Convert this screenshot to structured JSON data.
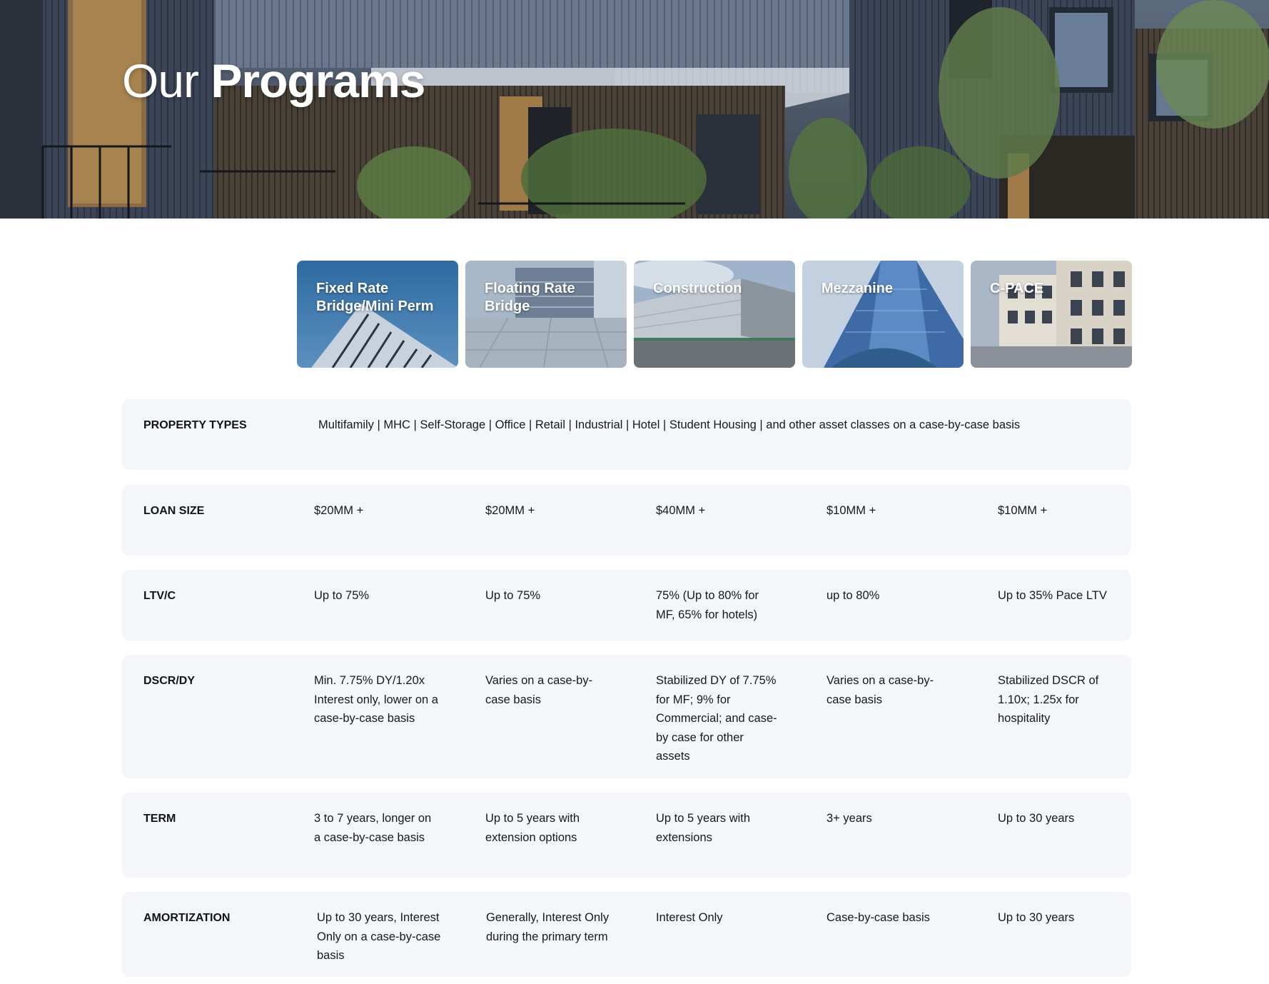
{
  "hero": {
    "title_light": "Our",
    "title_bold": "Programs"
  },
  "programs": [
    {
      "label": "Fixed Rate Bridge/Mini Perm",
      "art": "glass-building-photo"
    },
    {
      "label": "Floating Rate Bridge",
      "art": "plaza-office-photo"
    },
    {
      "label": "Construction",
      "art": "warehouse-photo"
    },
    {
      "label": "Mezzanine",
      "art": "glass-tower-photo"
    },
    {
      "label": "C-PACE",
      "art": "townhouse-facade-photo"
    }
  ],
  "rows": {
    "property_types": {
      "header": "PROPERTY TYPES",
      "value": "Multifamily | MHC | Self-Storage | Office | Retail | Industrial | Hotel | Student Housing | and other asset classes on a case-by-case basis"
    },
    "loan_size": {
      "header": "LOAN SIZE",
      "values": [
        "$20MM +",
        "$20MM +",
        "$40MM +",
        "$10MM +",
        "$10MM +"
      ]
    },
    "ltv": {
      "header": "LTV/C",
      "values": [
        "Up to 75%",
        "Up to 75%",
        "75% (Up to 80% for MF, 65% for hotels)",
        "up to 80%",
        "Up to 35% Pace LTV"
      ]
    },
    "dscr": {
      "header": "DSCR/DY",
      "values": [
        "Min. 7.75% DY/1.20x Interest only, lower on a case-by-case basis",
        "Varies on a case-by-case basis",
        "Stabilized DY of 7.75% for MF; 9% for Commercial; and case-by case for other assets",
        "Varies on a case-by-case basis",
        "Stabilized DSCR of 1.10x; 1.25x for hospitality"
      ]
    },
    "term": {
      "header": "TERM",
      "values": [
        "3 to 7 years, longer on a case-by-case basis",
        "Up to 5 years with extension options",
        "Up to 5 years with extensions",
        "3+ years",
        "Up to 30 years"
      ]
    },
    "amortization": {
      "header": "AMORTIZATION",
      "values": [
        "Up to 30 years, Interest Only on a case-by-case basis",
        "Generally, Interest Only during the primary term",
        "Interest Only",
        "Case-by-case basis",
        "Up to 30 years"
      ]
    }
  }
}
